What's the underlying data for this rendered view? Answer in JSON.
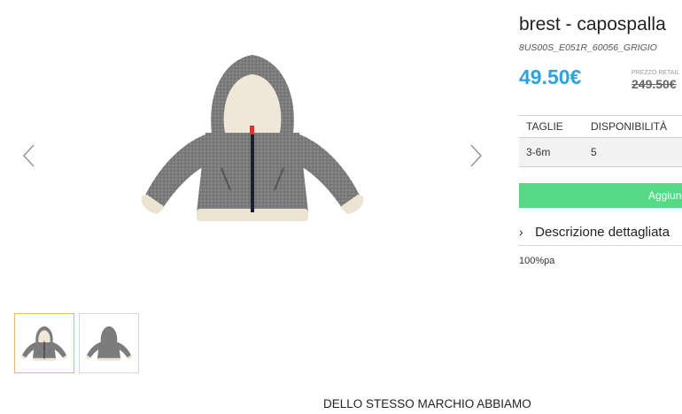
{
  "product": {
    "title": "brest - capospalla",
    "sku": "8US00S_E051R_60056_GRIGIO",
    "price": "49.50€",
    "retail_label": "PREZZO RETAIL",
    "retail_price": "249.50€"
  },
  "gallery": {
    "prev_icon": "chevron-left-icon",
    "next_icon": "chevron-right-icon",
    "image_label": "grey hooded jacket",
    "thumbnails": [
      {
        "view": "front",
        "selected": true
      },
      {
        "view": "back",
        "selected": false
      }
    ]
  },
  "sizes": {
    "headers": [
      "TAGLIE",
      "DISPONIBILITÀ"
    ],
    "rows": [
      {
        "size": "3-6m",
        "availability": "5"
      }
    ]
  },
  "actions": {
    "add_label": "Aggiungi al carrello"
  },
  "description": {
    "toggle_label": "Descrizione dettagliata",
    "text": "100%pa"
  },
  "related": {
    "heading": "DELLO STESSO MARCHIO ABBIAMO"
  },
  "colors": {
    "price": "#2ea3dc",
    "add_button": "#54d985",
    "thumb_active_border": "#e8b66a"
  }
}
